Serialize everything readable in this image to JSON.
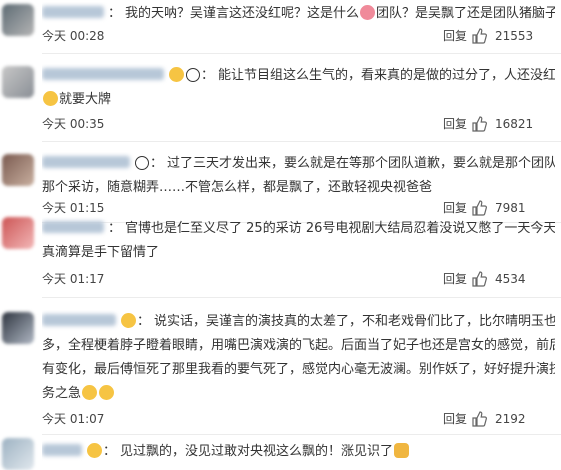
{
  "comments": [
    {
      "text_lines": [
        "我的天呐？吴谨言这还没红呢？这是什么",
        "团队？是吴飘了还是团队猪脑子？"
      ],
      "emojis": [
        "pig-face"
      ],
      "time": "今天 00:28",
      "reply_label": "回复",
      "likes": "21553"
    },
    {
      "text_lines": [
        "能让节目组这么生气的，看来真的是做的过分了，人还没红呢",
        "就要大牌"
      ],
      "emojis": [
        "panda",
        "crying-laughing",
        "crying-laughing"
      ],
      "time": "今天 00:35",
      "reply_label": "回复",
      "likes": "16821"
    },
    {
      "text_lines": [
        "过了三天才发出来，要么就是在等那个团队道歉，要么就是那个团队不重视",
        "那个采访，随意糊弄……不管怎么样，都是飘了，还敢轻视央视爸爸"
      ],
      "emojis": [],
      "time": "今天 01:15",
      "reply_label": "回复",
      "likes": "7981"
    },
    {
      "text_lines": [
        "官博也是仁至义尽了 25的采访 26号电视剧大结局忍着没说又憋了一天今天才说",
        "真滴算是手下留情了"
      ],
      "emojis": [],
      "time": "今天 01:17",
      "reply_label": "回复",
      "likes": "4534"
    },
    {
      "text_lines": [
        "说实话，吴谨言的演技真的太差了，不和老戏骨们比了，比尔晴明玉也差了好",
        "多，全程梗着脖子瞪着眼睛，用嘴巴演戏演的飞起。后面当了妃子也还是宫女的感觉，前后人物没",
        "有变化，最后傅恒死了那里我看的要气死了，感觉内心毫无波澜。别作妖了，好好提升演技才是当",
        "务之急"
      ],
      "emojis": [
        "crying-laughing",
        "crying-laughing",
        "crying-laughing"
      ],
      "time": "今天 01:07",
      "reply_label": "回复",
      "likes": "2192"
    },
    {
      "text_lines": [
        "见过飘的，没见过敢对央视这么飘的！涨见识了"
      ],
      "emojis": [
        "clapping-hands"
      ],
      "time": "",
      "reply_label": "",
      "likes": ""
    }
  ]
}
